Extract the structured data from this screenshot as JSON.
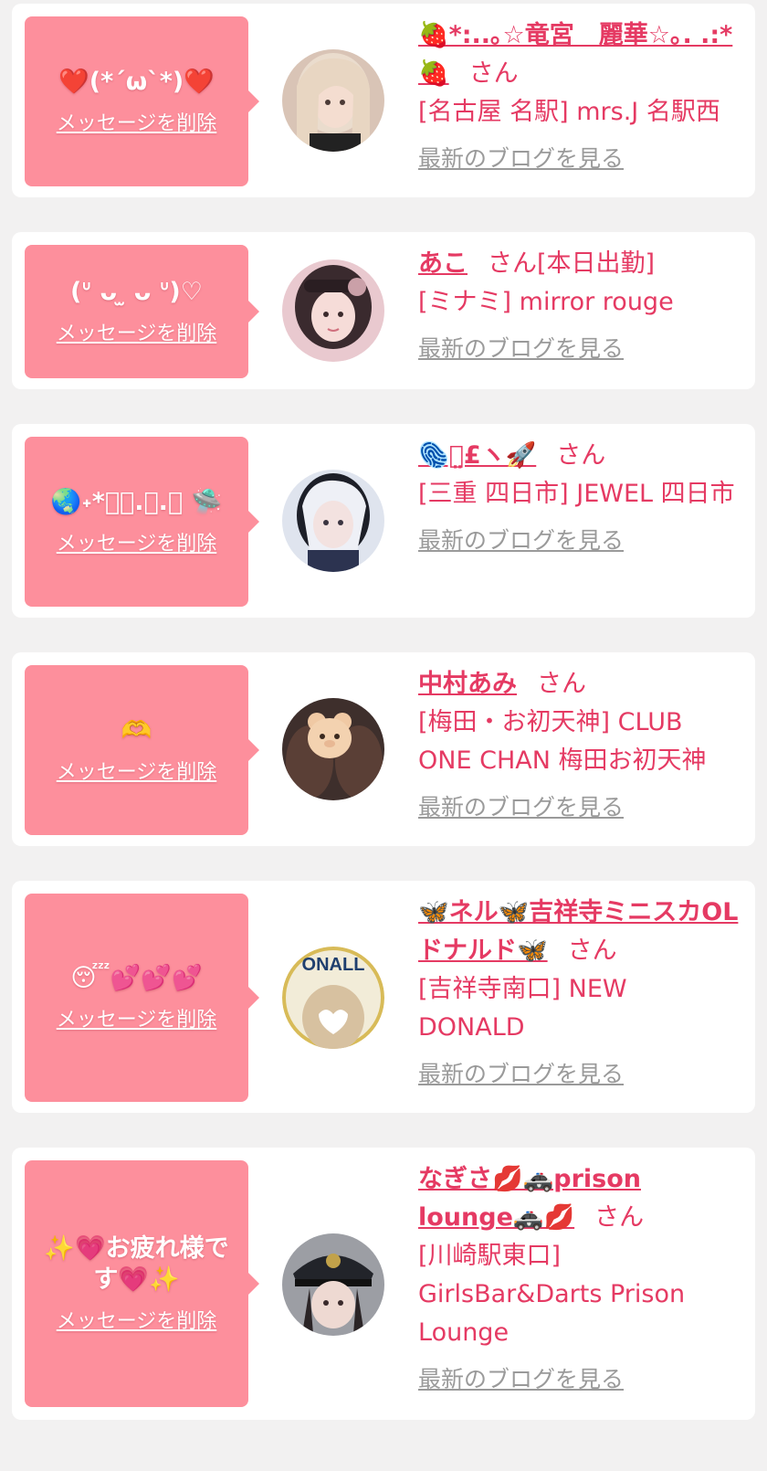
{
  "colors": {
    "page_bg": "#f2f1f1",
    "card_bg": "#ffffff",
    "bubble_bg": "#fd8f9c",
    "accent": "#e53a63",
    "muted_link": "#9a9a9a"
  },
  "items": [
    {
      "message": "❤️(*´ω`*)❤️",
      "delete_label": "メッセージを削除",
      "name": "🍓*:..｡☆竜宮　麗華☆｡. .:*🍓",
      "san": "さん",
      "today": "",
      "shop": "[名古屋 名駅] mrs.J 名駅西",
      "blog_label": "最新のブログを見る",
      "avatar_icon": "girl-avatar-blonde"
    },
    {
      "message": "(ᐡ ᴗ ̫ ᴗ ᐡ)♡",
      "delete_label": "メッセージを削除",
      "name": "あこ",
      "san": "さん",
      "today": "[本日出勤]",
      "shop": "[ミナミ] mirror rouge",
      "blog_label": "最新のブログを見る",
      "avatar_icon": "girl-avatar-dark-hair"
    },
    {
      "message": "🌏˖*ﾟ･.｡.ﾟ 🛸",
      "delete_label": "メッセージを削除",
      "name": "🫆ꪔ̤£ヽ🚀",
      "san": "さん",
      "today": "",
      "shop": "[三重 四日市] JEWEL 四日市",
      "blog_label": "最新のブログを見る",
      "avatar_icon": "girl-avatar-white-hair"
    },
    {
      "message": "🫶",
      "delete_label": "メッセージを削除",
      "name": "中村あみ",
      "san": "さん",
      "today": "",
      "shop": "[梅田・お初天神] CLUB ONE CHAN 梅田お初天神",
      "blog_label": "最新のブログを見る",
      "avatar_icon": "girl-avatar-bear-sticker"
    },
    {
      "message": "😴💕💕💕",
      "delete_label": "メッセージを削除",
      "name": "🦋ネル🦋吉祥寺ミニスカOLドナルド🦋",
      "san": "さん",
      "today": "",
      "shop": "[吉祥寺南口] NEW DONALD",
      "blog_label": "最新のブログを見る",
      "avatar_icon": "girl-avatar-donald-logo"
    },
    {
      "message": "✨💗お疲れ様です💗✨",
      "delete_label": "メッセージを削除",
      "name": "なぎさ💋🚓prison lounge🚓💋",
      "san": "さん",
      "today": "",
      "shop": "[川崎駅東口] GirlsBar&Darts Prison Lounge",
      "blog_label": "最新のブログを見る",
      "avatar_icon": "girl-avatar-police-cap"
    }
  ]
}
